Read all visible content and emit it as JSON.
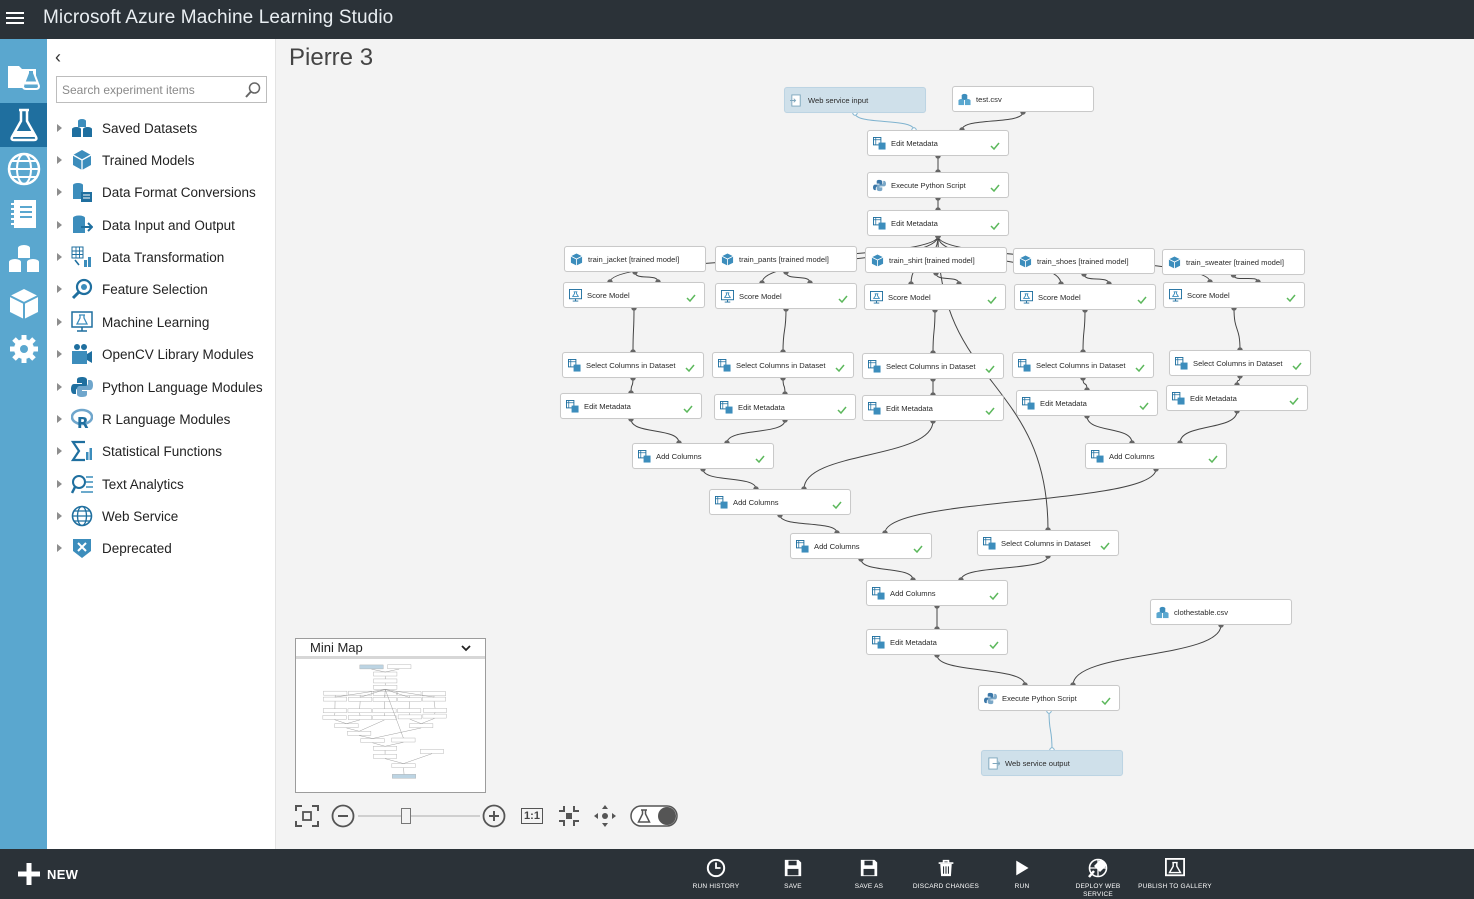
{
  "app": {
    "title": "Microsoft Azure Machine Learning Studio"
  },
  "colors": {
    "topbar": "#2b3238",
    "nav": "#5aa7cf",
    "nav_active": "#1f6f9f",
    "check": "#5cb85c",
    "node_ws": "#cfe0ea",
    "edge": "#444444",
    "edge_ws": "#7fb3cf"
  },
  "leftnav": {
    "items": [
      {
        "name": "projects",
        "icon": "folder-flask-icon"
      },
      {
        "name": "experiments",
        "icon": "flask-icon",
        "active": true
      },
      {
        "name": "web-services",
        "icon": "globe-icon"
      },
      {
        "name": "notebooks",
        "icon": "notebook-icon"
      },
      {
        "name": "datasets",
        "icon": "datasets-icon"
      },
      {
        "name": "trained-models",
        "icon": "cube-icon"
      },
      {
        "name": "settings",
        "icon": "gear-icon"
      }
    ]
  },
  "palette": {
    "search_placeholder": "Search experiment items",
    "categories": [
      {
        "label": "Saved Datasets",
        "icon": "datasets-icon"
      },
      {
        "label": "Trained Models",
        "icon": "cube-icon"
      },
      {
        "label": "Data Format Conversions",
        "icon": "conversion-icon"
      },
      {
        "label": "Data Input and Output",
        "icon": "data-io-icon"
      },
      {
        "label": "Data Transformation",
        "icon": "transform-icon"
      },
      {
        "label": "Feature Selection",
        "icon": "feature-icon"
      },
      {
        "label": "Machine Learning",
        "icon": "ml-icon"
      },
      {
        "label": "OpenCV Library Modules",
        "icon": "opencv-icon"
      },
      {
        "label": "Python Language Modules",
        "icon": "python-icon"
      },
      {
        "label": "R Language Modules",
        "icon": "r-icon"
      },
      {
        "label": "Statistical Functions",
        "icon": "sigma-icon"
      },
      {
        "label": "Text Analytics",
        "icon": "text-analytics-icon"
      },
      {
        "label": "Web Service",
        "icon": "globe-icon"
      },
      {
        "label": "Deprecated",
        "icon": "deprecated-icon"
      }
    ]
  },
  "experiment": {
    "title": "Pierre 3",
    "nodes": [
      {
        "id": "wsin",
        "label": "Web service input",
        "icon": "webservice-input-icon",
        "check": false
      },
      {
        "id": "test",
        "label": "test.csv",
        "icon": "dataset-icon",
        "check": false
      },
      {
        "id": "em1",
        "label": "Edit Metadata",
        "icon": "module-icon",
        "check": true
      },
      {
        "id": "py1",
        "label": "Execute Python Script",
        "icon": "python-icon",
        "check": true
      },
      {
        "id": "em2",
        "label": "Edit Metadata",
        "icon": "module-icon",
        "check": true
      },
      {
        "id": "tj",
        "label": "train_jacket [trained model]",
        "icon": "cube-icon",
        "check": false
      },
      {
        "id": "tp",
        "label": "train_pants [trained model]",
        "icon": "cube-icon",
        "check": false
      },
      {
        "id": "tsh",
        "label": "train_shirt [trained model]",
        "icon": "cube-icon",
        "check": false
      },
      {
        "id": "tso",
        "label": "train_shoes [trained model]",
        "icon": "cube-icon",
        "check": false
      },
      {
        "id": "tsw",
        "label": "train_sweater [trained model]",
        "icon": "cube-icon",
        "check": false
      },
      {
        "id": "s1",
        "label": "Score Model",
        "icon": "score-icon",
        "check": true
      },
      {
        "id": "s2",
        "label": "Score Model",
        "icon": "score-icon",
        "check": true
      },
      {
        "id": "s3",
        "label": "Score Model",
        "icon": "score-icon",
        "check": true
      },
      {
        "id": "s4",
        "label": "Score Model",
        "icon": "score-icon",
        "check": true
      },
      {
        "id": "s5",
        "label": "Score Model",
        "icon": "score-icon",
        "check": true
      },
      {
        "id": "sc1",
        "label": "Select Columns in Dataset",
        "icon": "module-icon",
        "check": true
      },
      {
        "id": "sc2",
        "label": "Select Columns in Dataset",
        "icon": "module-icon",
        "check": true
      },
      {
        "id": "sc3",
        "label": "Select Columns in Dataset",
        "icon": "module-icon",
        "check": true
      },
      {
        "id": "sc4",
        "label": "Select Columns in Dataset",
        "icon": "module-icon",
        "check": true
      },
      {
        "id": "sc5",
        "label": "Select Columns in Dataset",
        "icon": "module-icon",
        "check": true
      },
      {
        "id": "e1",
        "label": "Edit Metadata",
        "icon": "module-icon",
        "check": true
      },
      {
        "id": "e2",
        "label": "Edit Metadata",
        "icon": "module-icon",
        "check": true
      },
      {
        "id": "e3",
        "label": "Edit Metadata",
        "icon": "module-icon",
        "check": true
      },
      {
        "id": "e4",
        "label": "Edit Metadata",
        "icon": "module-icon",
        "check": true
      },
      {
        "id": "e5",
        "label": "Edit Metadata",
        "icon": "module-icon",
        "check": true
      },
      {
        "id": "ac1",
        "label": "Add Columns",
        "icon": "module-icon",
        "check": true
      },
      {
        "id": "ac2",
        "label": "Add Columns",
        "icon": "module-icon",
        "check": true
      },
      {
        "id": "ac3",
        "label": "Add Columns",
        "icon": "module-icon",
        "check": true
      },
      {
        "id": "ac4",
        "label": "Add Columns",
        "icon": "module-icon",
        "check": true
      },
      {
        "id": "sc6",
        "label": "Select Columns in Dataset",
        "icon": "module-icon",
        "check": true
      },
      {
        "id": "ac5",
        "label": "Add Columns",
        "icon": "module-icon",
        "check": true
      },
      {
        "id": "em3",
        "label": "Edit Metadata",
        "icon": "module-icon",
        "check": true
      },
      {
        "id": "cloth",
        "label": "clothestable.csv",
        "icon": "dataset-icon",
        "check": false
      },
      {
        "id": "py2",
        "label": "Execute Python Script",
        "icon": "python-icon",
        "check": true
      },
      {
        "id": "wsout",
        "label": "Web service output",
        "icon": "webservice-output-icon",
        "check": false
      }
    ],
    "edges": [
      [
        "wsin",
        "em1"
      ],
      [
        "test",
        "em1"
      ],
      [
        "em1",
        "py1"
      ],
      [
        "py1",
        "em2"
      ],
      [
        "em2",
        "s1"
      ],
      [
        "em2",
        "s2"
      ],
      [
        "em2",
        "s3"
      ],
      [
        "em2",
        "s4"
      ],
      [
        "em2",
        "s5"
      ],
      [
        "em2",
        "sc6"
      ],
      [
        "tj",
        "s1"
      ],
      [
        "tp",
        "s2"
      ],
      [
        "tsh",
        "s3"
      ],
      [
        "tso",
        "s4"
      ],
      [
        "tsw",
        "s5"
      ],
      [
        "s1",
        "sc1"
      ],
      [
        "s2",
        "sc2"
      ],
      [
        "s3",
        "sc3"
      ],
      [
        "s4",
        "sc4"
      ],
      [
        "s5",
        "sc5"
      ],
      [
        "sc1",
        "e1"
      ],
      [
        "sc2",
        "e2"
      ],
      [
        "sc3",
        "e3"
      ],
      [
        "sc4",
        "e4"
      ],
      [
        "sc5",
        "e5"
      ],
      [
        "e1",
        "ac1"
      ],
      [
        "e2",
        "ac1"
      ],
      [
        "e4",
        "ac2"
      ],
      [
        "e5",
        "ac2"
      ],
      [
        "ac1",
        "ac3"
      ],
      [
        "e3",
        "ac3"
      ],
      [
        "ac3",
        "ac4"
      ],
      [
        "ac2",
        "ac4"
      ],
      [
        "ac4",
        "ac5"
      ],
      [
        "sc6",
        "ac5"
      ],
      [
        "ac5",
        "em3"
      ],
      [
        "em3",
        "py2"
      ],
      [
        "cloth",
        "py2"
      ],
      [
        "py2",
        "wsout"
      ]
    ]
  },
  "minimap": {
    "title": "Mini Map"
  },
  "zoom": {
    "level": 0.4,
    "actual_size_label": "1:1"
  },
  "commands": {
    "new_label": "NEW",
    "items": [
      {
        "label": "RUN HISTORY",
        "icon": "clock-icon"
      },
      {
        "label": "SAVE",
        "icon": "save-icon"
      },
      {
        "label": "SAVE AS",
        "icon": "save-as-icon"
      },
      {
        "label": "DISCARD CHANGES",
        "icon": "trash-icon"
      },
      {
        "label": "RUN",
        "icon": "play-icon"
      },
      {
        "label": "DEPLOY WEB SERVICE",
        "icon": "deploy-icon"
      },
      {
        "label": "PUBLISH TO GALLERY",
        "icon": "publish-icon"
      }
    ]
  }
}
